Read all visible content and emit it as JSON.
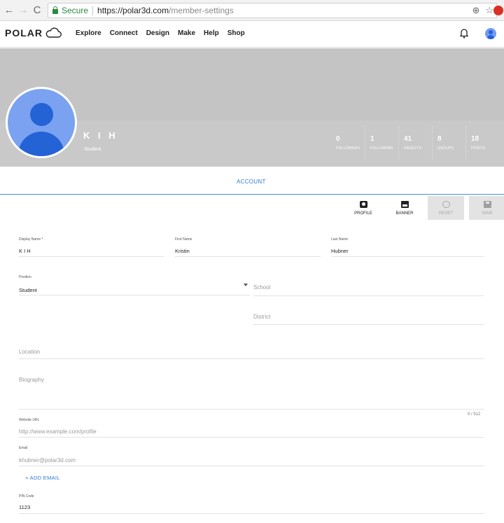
{
  "browser": {
    "back": "←",
    "forward": "→",
    "reload": "C",
    "secure_label": "Secure",
    "url_host": "https://polar3d.com",
    "url_path": "/member-settings",
    "zoom_icon": "⊕",
    "star_icon": "☆"
  },
  "header": {
    "logo_text": "POLAR",
    "nav": [
      "Explore",
      "Connect",
      "Design",
      "Make",
      "Help",
      "Shop"
    ]
  },
  "profile": {
    "display_name": "K I H",
    "role": "Student",
    "stats": [
      {
        "value": "0",
        "label": "FOLLOWERS"
      },
      {
        "value": "1",
        "label": "FOLLOWING"
      },
      {
        "value": "41",
        "label": "OBJECTS"
      },
      {
        "value": "8",
        "label": "GROUPS"
      },
      {
        "value": "18",
        "label": "PRINTS"
      }
    ]
  },
  "tabs": {
    "account": "ACCOUNT"
  },
  "toolbar": {
    "profile": "PROFILE",
    "banner": "BANNER",
    "reset": "RESET",
    "save": "SAVE"
  },
  "form": {
    "display_name": {
      "label": "Display Name *",
      "value": "K I H"
    },
    "first_name": {
      "label": "First Name",
      "value": "Kristin"
    },
    "last_name": {
      "label": "Last Name",
      "value": "Hubner"
    },
    "position": {
      "label": "Position",
      "value": "Student"
    },
    "school": {
      "placeholder": "School"
    },
    "district": {
      "placeholder": "District"
    },
    "location": {
      "placeholder": "Location"
    },
    "biography": {
      "placeholder": "Biography",
      "counter": "0 / 512"
    },
    "website": {
      "label": "Website URL",
      "placeholder": "http://www.example.com/profile"
    },
    "email": {
      "label": "Email",
      "value": "khubner@polar3d.com"
    },
    "add_email": "+ ADD EMAIL",
    "pin_code": {
      "label": "PIN Code",
      "value": "1123"
    }
  }
}
